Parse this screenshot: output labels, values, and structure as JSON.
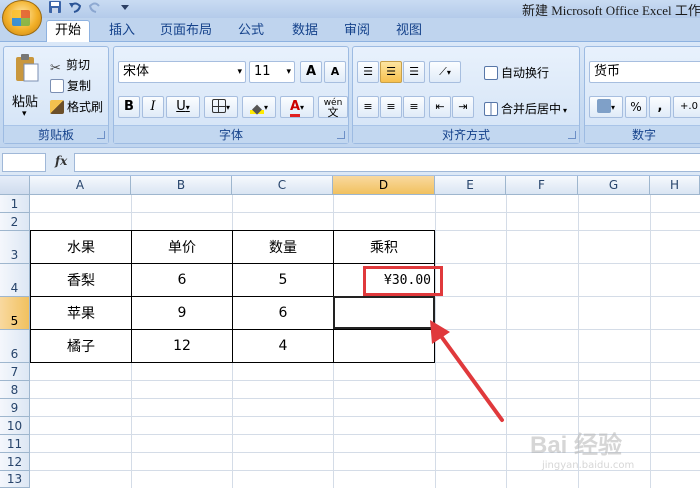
{
  "window": {
    "title": "新建 Microsoft Office Excel 工作"
  },
  "tabs": [
    {
      "label": "开始",
      "active": true
    },
    {
      "label": "插入"
    },
    {
      "label": "页面布局"
    },
    {
      "label": "公式"
    },
    {
      "label": "数据"
    },
    {
      "label": "审阅"
    },
    {
      "label": "视图"
    }
  ],
  "clipboard": {
    "paste": "粘贴",
    "cut": "剪切",
    "copy": "复制",
    "format_painter": "格式刷",
    "caption": "剪贴板"
  },
  "font": {
    "name": "宋体",
    "size": "11",
    "grow": "A",
    "shrink": "A",
    "bold": "B",
    "italic": "I",
    "underline": "U",
    "color_letter": "A",
    "wen": "wén",
    "wen_char": "文",
    "caption": "字体"
  },
  "alignment": {
    "wrap": "自动换行",
    "merge": "合并后居中",
    "caption": "对齐方式"
  },
  "number": {
    "format": "货币",
    "percent": "%",
    "comma": ",",
    "decimal": "+.0",
    "caption": "数字"
  },
  "formula_bar": {
    "fx": "fx",
    "name_box": "",
    "content": ""
  },
  "columns": [
    "A",
    "B",
    "C",
    "D",
    "E",
    "F",
    "G",
    "H"
  ],
  "rows": [
    "1",
    "2",
    "3",
    "4",
    "5",
    "6",
    "7",
    "8",
    "9",
    "10",
    "11",
    "12",
    "13"
  ],
  "selected": {
    "column": "D",
    "row": "5"
  },
  "table": {
    "headers": [
      "水果",
      "单价",
      "数量",
      "乘积"
    ],
    "rows": [
      [
        "香梨",
        "6",
        "5",
        "¥30.00"
      ],
      [
        "苹果",
        "9",
        "6",
        ""
      ],
      [
        "橘子",
        "12",
        "4",
        ""
      ]
    ]
  },
  "colors": {
    "accent_red": "#e0393c",
    "ribbon_bg": "#c5d9f1",
    "selection_header": "#f1c15f"
  },
  "watermark": {
    "text": "Bai 经验",
    "url": "jingyan.baidu.com"
  }
}
